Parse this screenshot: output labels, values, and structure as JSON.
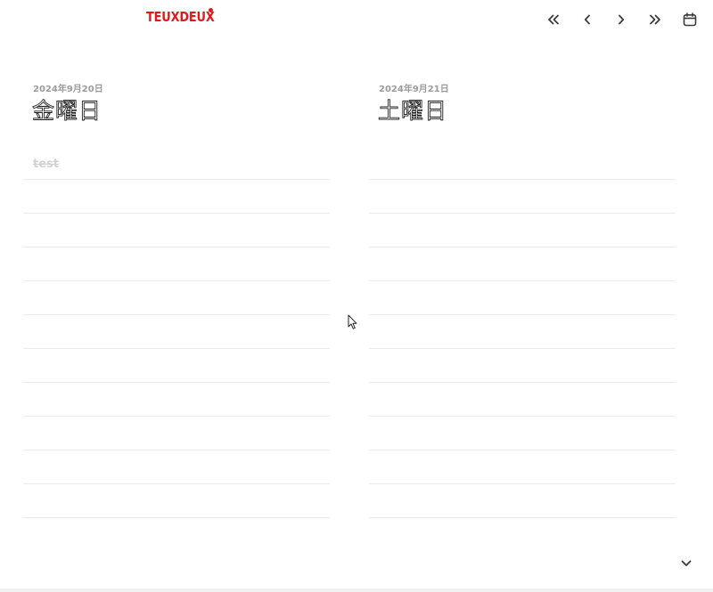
{
  "header": {
    "logo": "TEUXDEUX",
    "nav": {
      "prev_week_icon": "double-chevron-left-icon",
      "prev_day_icon": "chevron-left-icon",
      "next_day_icon": "chevron-right-icon",
      "next_week_icon": "double-chevron-right-icon",
      "calendar_icon": "calendar-icon"
    }
  },
  "days": [
    {
      "date": "2024年9月20日",
      "weekday": "金曜日",
      "todos": [
        {
          "text": "test",
          "done": true
        }
      ]
    },
    {
      "date": "2024年9月21日",
      "weekday": "土曜日",
      "todos": []
    }
  ],
  "footer": {
    "expand_icon": "chevron-down-icon"
  },
  "colors": {
    "brand": "#e4191b",
    "date_text": "#9b9b9b",
    "done_text": "#d2d2d2",
    "line": "#ececec"
  }
}
